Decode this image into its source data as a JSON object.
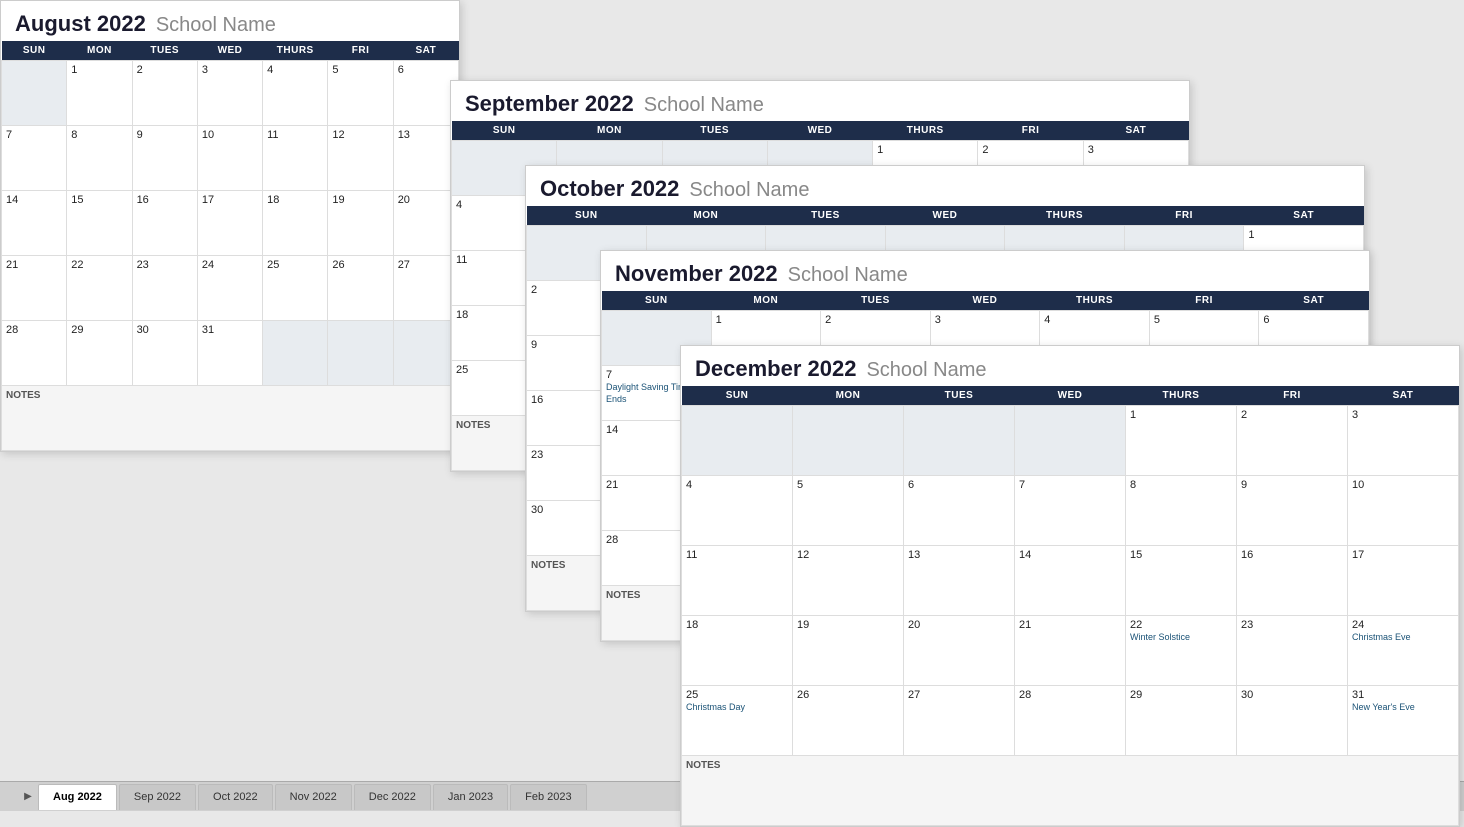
{
  "tabs": [
    {
      "label": "Aug 2022",
      "active": true
    },
    {
      "label": "Sep 2022",
      "active": false
    },
    {
      "label": "Oct 2022",
      "active": false
    },
    {
      "label": "Nov 2022",
      "active": false
    },
    {
      "label": "Dec 2022",
      "active": false
    },
    {
      "label": "Jan 2023",
      "active": false
    },
    {
      "label": "Feb 2023",
      "active": false
    }
  ],
  "calendars": {
    "august": {
      "title": "August 2022",
      "school": "School Name",
      "days": [
        "SUN",
        "MON",
        "TUES",
        "WED",
        "THURS",
        "FRI",
        "SAT"
      ]
    },
    "september": {
      "title": "September 2022",
      "school": "School Name",
      "days": [
        "SUN",
        "MON",
        "TUES",
        "WED",
        "THURS",
        "FRI",
        "SAT"
      ]
    },
    "october": {
      "title": "October 2022",
      "school": "School Name",
      "days": [
        "SUN",
        "MON",
        "TUES",
        "WED",
        "THURS",
        "FRI",
        "SAT"
      ]
    },
    "november": {
      "title": "November 2022",
      "school": "School Name",
      "days": [
        "SUN",
        "MON",
        "TUES",
        "WED",
        "THURS",
        "FRI",
        "SAT"
      ]
    },
    "december": {
      "title": "December 2022",
      "school": "School Name",
      "days": [
        "SUN",
        "MON",
        "TUES",
        "WED",
        "THURS",
        "FRI",
        "SAT"
      ]
    }
  },
  "notes_label": "NOTES",
  "events": {
    "daylight_saving": "Daylight Saving Time Ends",
    "winter_solstice": "Winter Solstice",
    "christmas_eve": "Christmas Eve",
    "christmas_day": "Christmas Day",
    "new_years_eve": "New Year's Eve"
  }
}
